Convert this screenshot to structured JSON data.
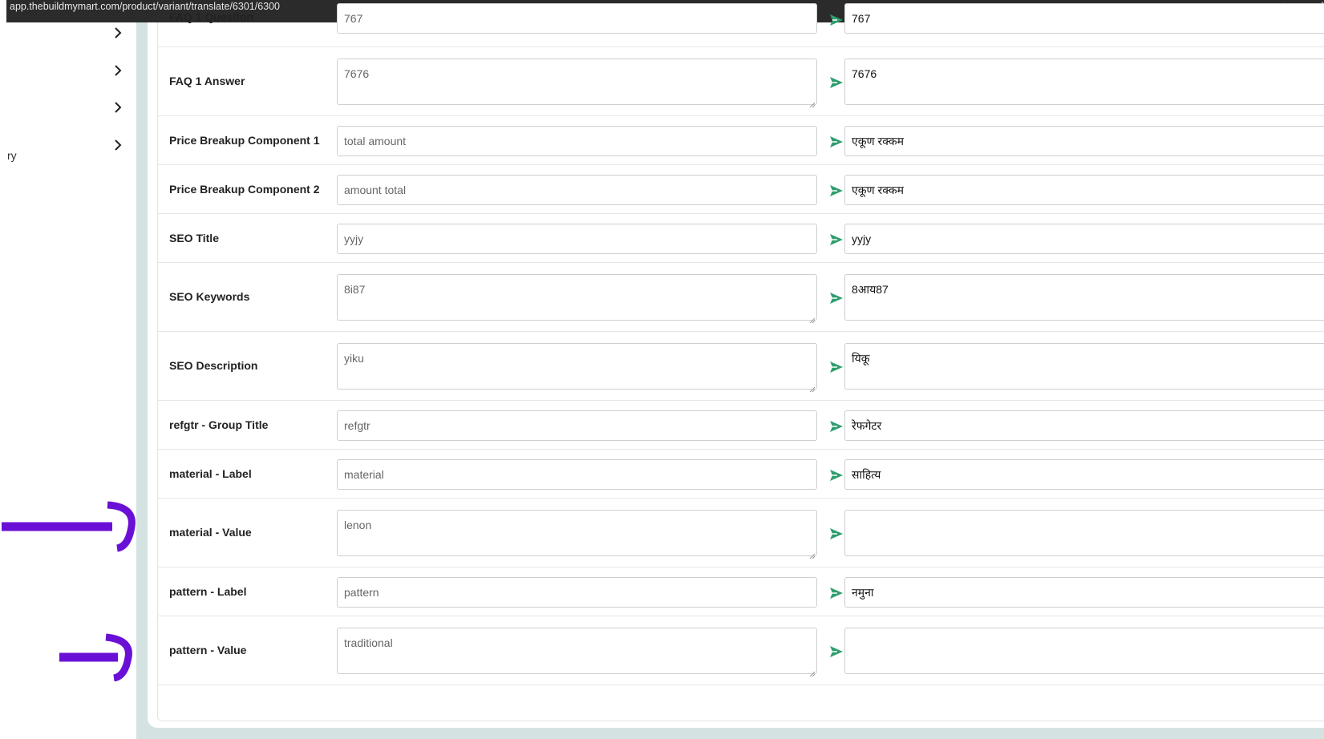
{
  "browser": {
    "url": "app.thebuildmymart.com/product/variant/translate/6301/6300"
  },
  "sidebar": {
    "partial_label": "ry"
  },
  "colors": {
    "send_icon": "#2e9e6e",
    "annotation_arrow": "#6a10d6",
    "frame": "#d4e3e1"
  },
  "rows": [
    {
      "label": "FAQ 1 Question",
      "source": "767",
      "target": "767",
      "multiline": false
    },
    {
      "label": "FAQ 1 Answer",
      "source": "7676",
      "target": "7676",
      "multiline": true
    },
    {
      "label": "Price Breakup Component 1",
      "source": "total amount",
      "target": "एकूण रक्कम",
      "multiline": false
    },
    {
      "label": "Price Breakup Component 2",
      "source": "amount total",
      "target": "एकूण रक्कम",
      "multiline": false
    },
    {
      "label": "SEO Title",
      "source": "yyjy",
      "target": "yyjy",
      "multiline": false
    },
    {
      "label": "SEO Keywords",
      "source": "8i87",
      "target": "8आय87",
      "multiline": true
    },
    {
      "label": "SEO Description",
      "source": "yiku",
      "target": "यिकू",
      "multiline": true
    },
    {
      "label": "refgtr - Group Title",
      "source": "refgtr",
      "target": "रेफगेटर",
      "multiline": false
    },
    {
      "label": "material - Label",
      "source": "material",
      "target": "साहित्य",
      "multiline": false
    },
    {
      "label": "material - Value",
      "source": "lenon",
      "target": "",
      "multiline": true
    },
    {
      "label": "pattern - Label",
      "source": "pattern",
      "target": "नमुना",
      "multiline": false
    },
    {
      "label": "pattern - Value",
      "source": "traditional",
      "target": "",
      "multiline": true
    }
  ],
  "icons": {
    "send": "send-icon",
    "chevron": "chevron-right-icon",
    "star": "star-icon",
    "annotation": "arrow-right-icon"
  }
}
